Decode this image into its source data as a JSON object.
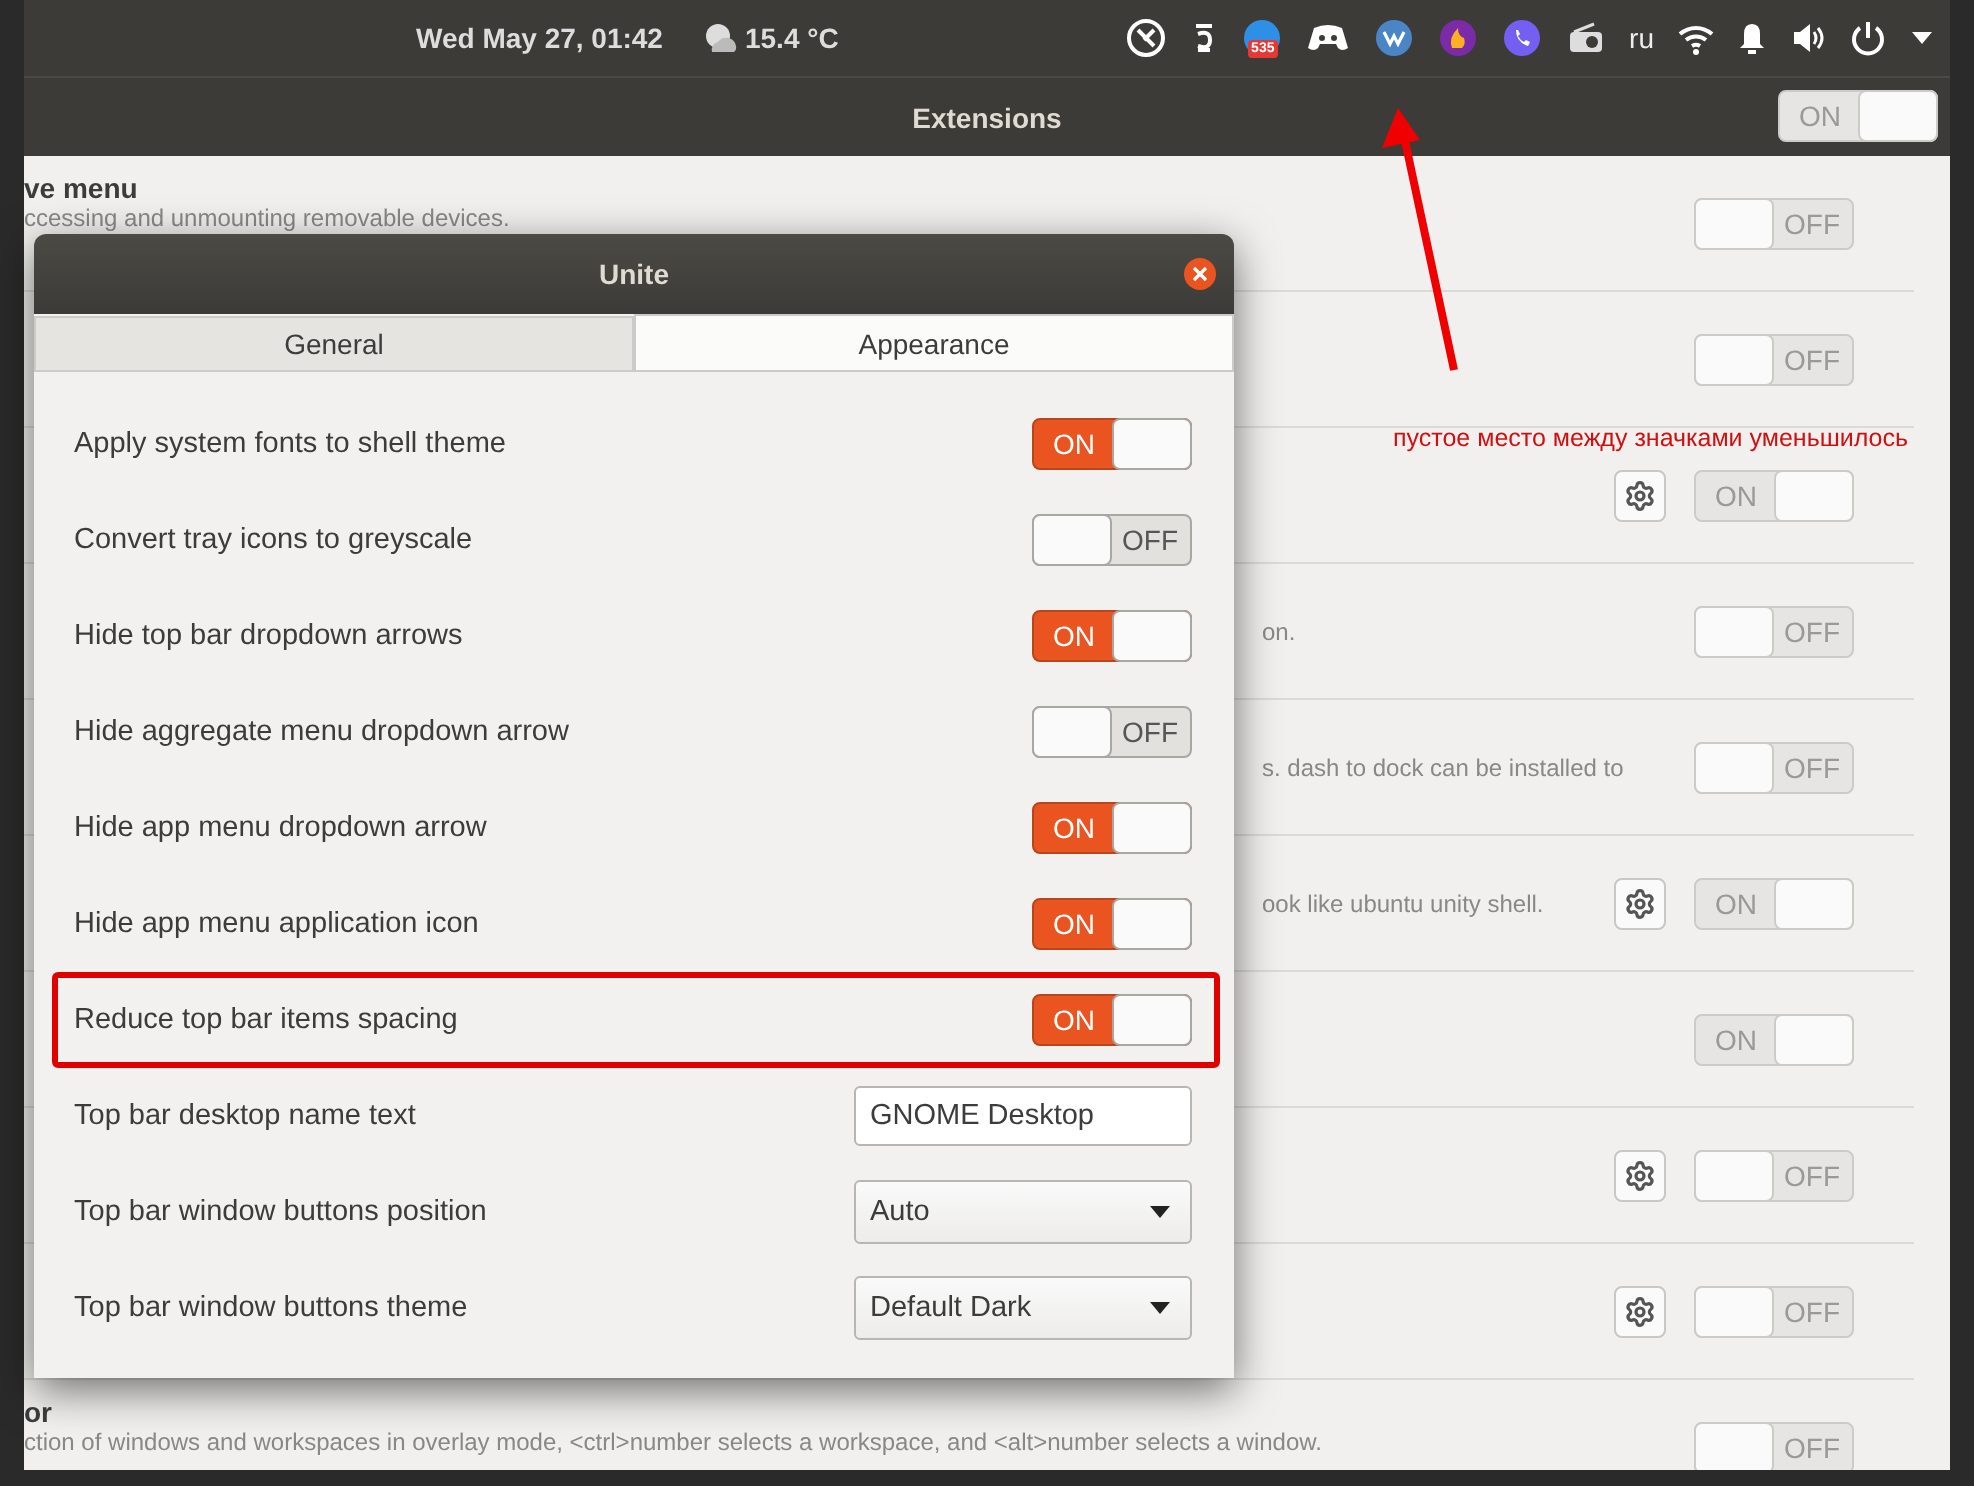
{
  "top_bar": {
    "clock": "Wed May 27, 01:42",
    "weather": "15.4 °C",
    "badge_count": "535",
    "keyboard_layout": "ru"
  },
  "background_window": {
    "title": "Extensions",
    "master_switch": {
      "on": true,
      "text": "ON"
    },
    "rows": [
      {
        "title": "ve menu",
        "description": "ccessing and unmounting removable devices.",
        "settings_button": false,
        "switch": {
          "on": false,
          "text": "OFF"
        }
      },
      {
        "settings_button": false,
        "switch": {
          "on": false,
          "text": "OFF"
        }
      },
      {
        "settings_button": true,
        "switch": {
          "on": true,
          "text": "ON"
        }
      },
      {
        "fragment": "on.",
        "settings_button": false,
        "switch": {
          "on": false,
          "text": "OFF"
        }
      },
      {
        "fragment": "s. dash to dock can be installed to",
        "settings_button": false,
        "switch": {
          "on": false,
          "text": "OFF"
        }
      },
      {
        "fragment": "ook like ubuntu unity shell.",
        "settings_button": true,
        "switch": {
          "on": true,
          "text": "ON"
        }
      },
      {
        "settings_button": false,
        "switch": {
          "on": true,
          "text": "ON"
        }
      },
      {
        "settings_button": true,
        "switch": {
          "on": false,
          "text": "OFF"
        }
      },
      {
        "settings_button": true,
        "switch": {
          "on": false,
          "text": "OFF"
        }
      },
      {
        "title": "or",
        "description": "ction of windows and workspaces in overlay mode, <ctrl>number selects a workspace, and <alt>number selects a window.",
        "settings_button": false,
        "switch": {
          "on": false,
          "text": "OFF"
        }
      }
    ]
  },
  "dialog": {
    "title": "Unite",
    "tabs": [
      {
        "label": "General",
        "selected": false
      },
      {
        "label": "Appearance",
        "selected": true
      }
    ],
    "rows": [
      {
        "kind": "switch",
        "label": "Apply system fonts to shell theme",
        "on": true,
        "text": "ON",
        "highlighted": false
      },
      {
        "kind": "switch",
        "label": "Convert tray icons to greyscale",
        "on": false,
        "text": "OFF",
        "highlighted": false
      },
      {
        "kind": "switch",
        "label": "Hide top bar dropdown arrows",
        "on": true,
        "text": "ON",
        "highlighted": false
      },
      {
        "kind": "switch",
        "label": "Hide aggregate menu dropdown arrow",
        "on": false,
        "text": "OFF",
        "highlighted": false
      },
      {
        "kind": "switch",
        "label": "Hide app menu dropdown arrow",
        "on": true,
        "text": "ON",
        "highlighted": false
      },
      {
        "kind": "switch",
        "label": "Hide app menu application icon",
        "on": true,
        "text": "ON",
        "highlighted": false
      },
      {
        "kind": "switch",
        "label": "Reduce top bar items spacing",
        "on": true,
        "text": "ON",
        "highlighted": true
      },
      {
        "kind": "entry",
        "label": "Top bar desktop name text",
        "value": "GNOME Desktop",
        "highlighted": false
      },
      {
        "kind": "dropdown",
        "label": "Top bar window buttons position",
        "value": "Auto",
        "highlighted": false
      },
      {
        "kind": "dropdown",
        "label": "Top bar window buttons theme",
        "value": "Default Dark",
        "highlighted": false
      }
    ]
  },
  "annotation": {
    "text": "пустое место между значками уменьшилось"
  }
}
